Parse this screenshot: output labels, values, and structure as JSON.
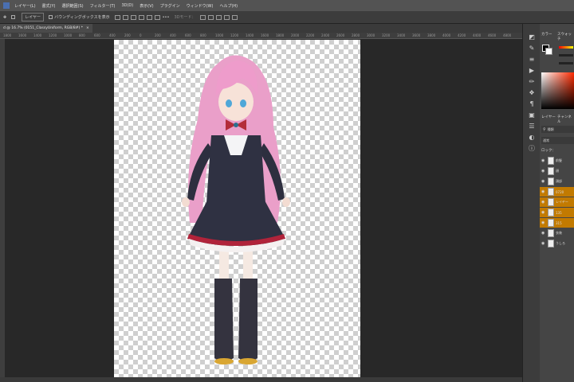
{
  "menu": {
    "items": [
      "レイヤー(L)",
      "書式(Y)",
      "選択範囲(S)",
      "フィルター(T)",
      "3D(D)",
      "表示(V)",
      "プラグイン",
      "ウィンドウ(W)",
      "ヘルプ(H)"
    ]
  },
  "options": {
    "layer_select": "レイヤー",
    "bounding_box_label": "バウンディングボックスを表示",
    "mode_3d": "3Dモード："
  },
  "document": {
    "tab_title": "d @ 16.7% (0151_ClassyUniform, RGB/8#) *",
    "close": "×"
  },
  "ruler": {
    "ticks": [
      "1800",
      "1600",
      "1400",
      "1200",
      "1000",
      "800",
      "600",
      "400",
      "200",
      "0",
      "200",
      "400",
      "600",
      "800",
      "1000",
      "1200",
      "1400",
      "1600",
      "1800",
      "2000",
      "2200",
      "2400",
      "2600",
      "2800",
      "3000",
      "3200",
      "3400",
      "3600",
      "3800",
      "4000",
      "4200",
      "4400",
      "4600",
      "4800"
    ]
  },
  "panels": {
    "color_tab": "カラー",
    "swatches_tab": "スウォッチ",
    "layers_tab": "レイヤー",
    "channels_tab": "チャンネル",
    "search_label": "種類",
    "blend_mode": "通常",
    "lock_label": "ロック："
  },
  "layers": [
    {
      "name": "前髪",
      "visible": true,
      "selected": false
    },
    {
      "name": "顔",
      "visible": true,
      "selected": false
    },
    {
      "name": "頭部",
      "visible": true,
      "selected": false
    },
    {
      "name": "0720",
      "visible": true,
      "selected": true
    },
    {
      "name": "レイヤー",
      "visible": true,
      "selected": true
    },
    {
      "name": "135",
      "visible": true,
      "selected": true
    },
    {
      "name": "315",
      "visible": true,
      "selected": true
    },
    {
      "name": "衣装",
      "visible": true,
      "selected": false
    },
    {
      "name": "うしろ",
      "visible": true,
      "selected": false
    }
  ],
  "colors": {
    "accent_selected_layer": "#c27a00",
    "panel_bg": "#454545",
    "workspace_bg": "#282828"
  }
}
